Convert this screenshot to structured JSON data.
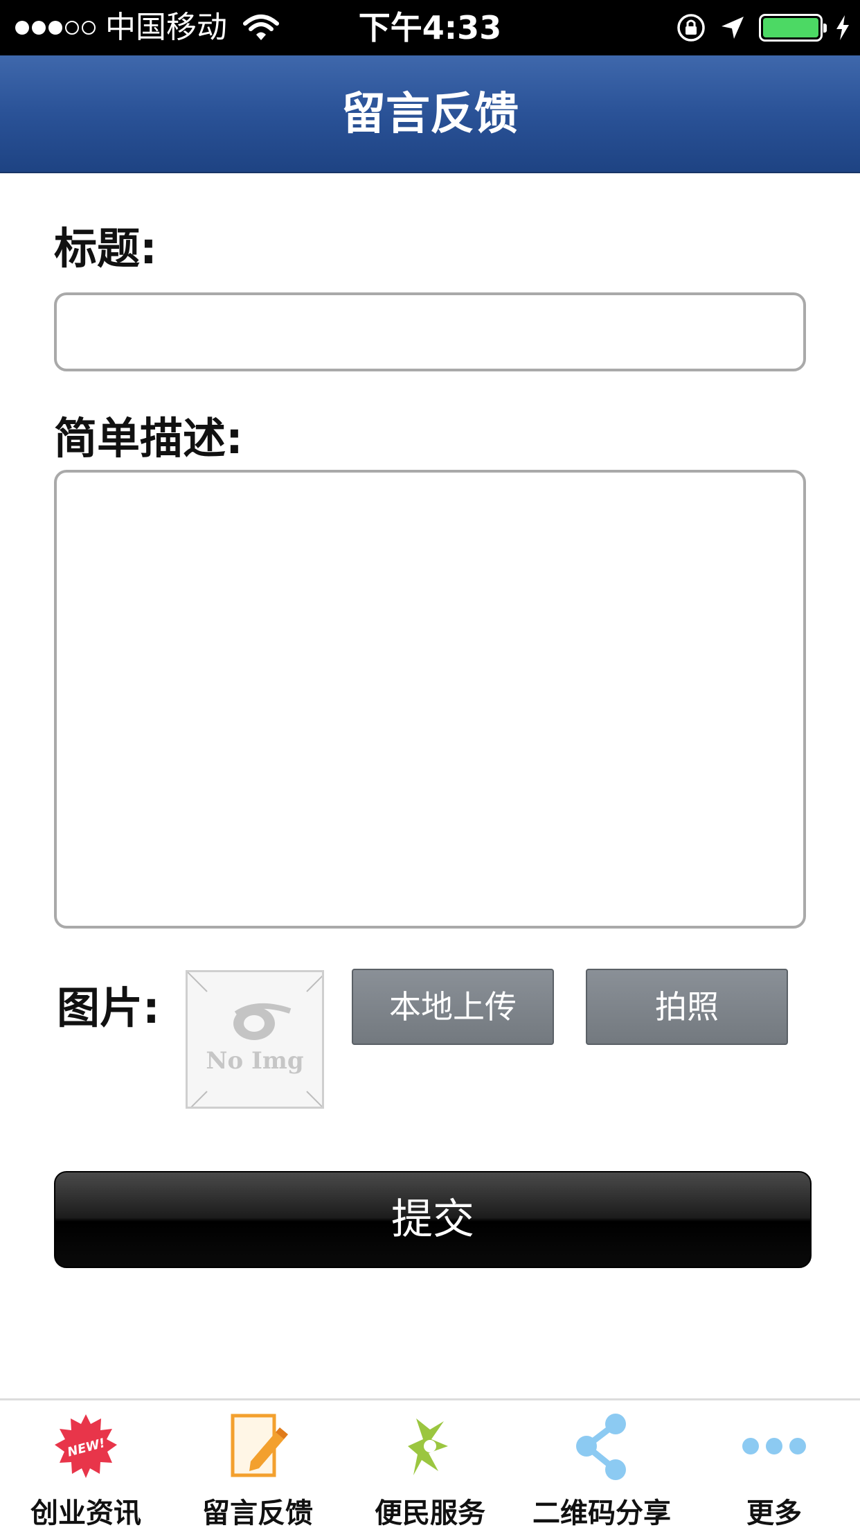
{
  "status_bar": {
    "carrier": "中国移动",
    "time": "下午4:33",
    "battery_level": 1.0,
    "signal_bars_filled": 3,
    "signal_bars_total": 5
  },
  "nav": {
    "title": "留言反馈"
  },
  "form": {
    "title_label": "标题:",
    "title_value": "",
    "description_label": "简单描述:",
    "description_value": "",
    "image_label": "图片:",
    "placeholder_image_text": "No Img",
    "upload_button": "本地上传",
    "photo_button": "拍照",
    "submit_button": "提交"
  },
  "tab_bar": {
    "items": [
      {
        "label": "创业资讯",
        "icon": "new-badge-icon"
      },
      {
        "label": "留言反馈",
        "icon": "edit-note-icon"
      },
      {
        "label": "便民服务",
        "icon": "service-icon"
      },
      {
        "label": "二维码分享",
        "icon": "share-icon"
      },
      {
        "label": "更多",
        "icon": "more-dots-icon"
      }
    ]
  },
  "colors": {
    "nav_blue": "#2a5297",
    "button_gray": "#7c8288",
    "submit_black": "#111111",
    "new_badge_red": "#e8354a",
    "share_blue": "#8ccaf2",
    "service_green": "#9bc640",
    "note_orange": "#f3a02e",
    "battery_green": "#4cd964"
  }
}
